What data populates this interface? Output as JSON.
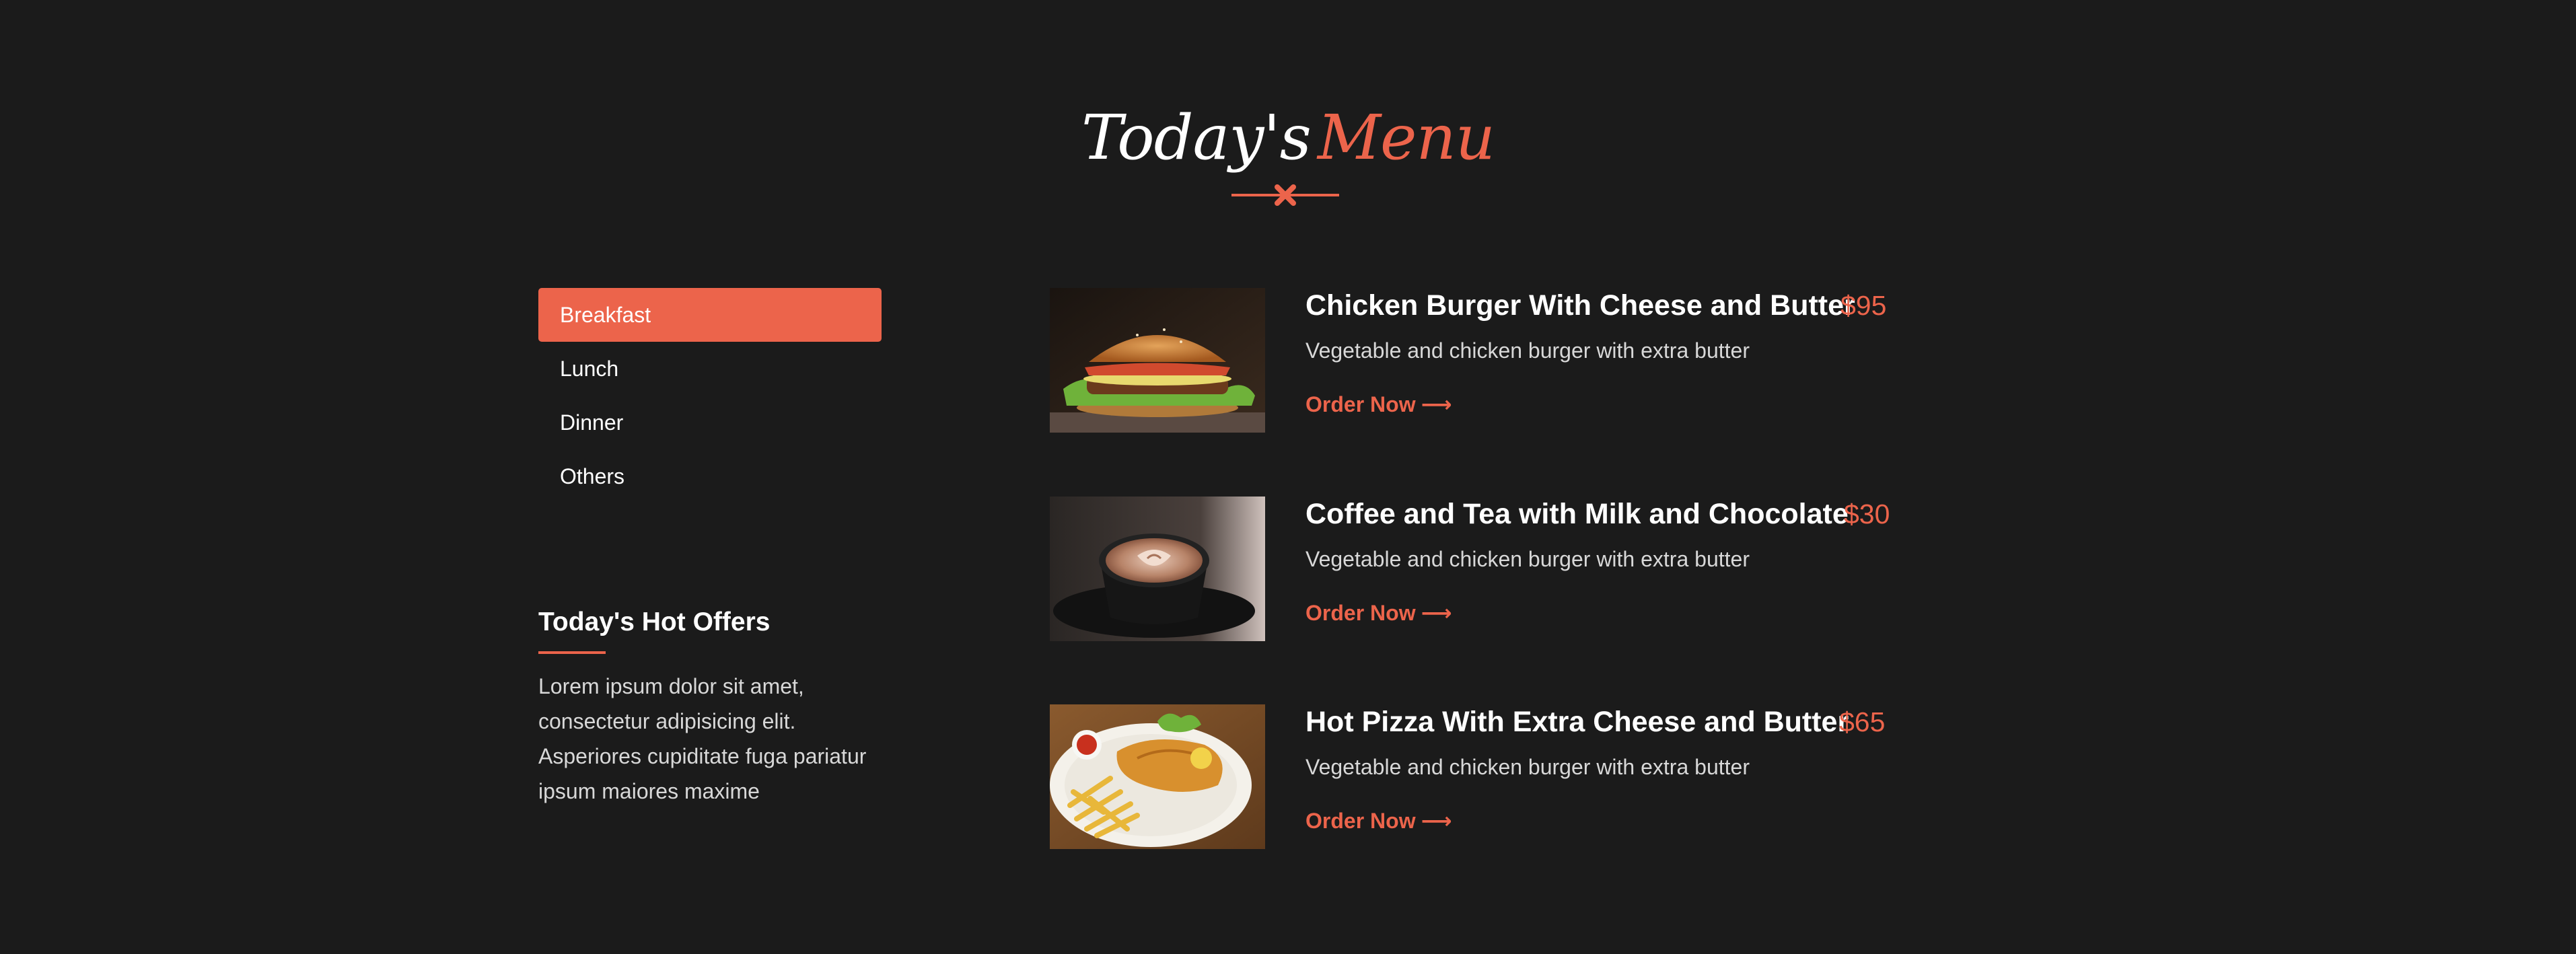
{
  "heading": {
    "word1": "Today's",
    "word2": "Menu"
  },
  "colors": {
    "accent": "#ec644b",
    "background": "#1b1b1b",
    "text": "#ffffff"
  },
  "tabs": [
    {
      "label": "Breakfast",
      "active": true
    },
    {
      "label": "Lunch",
      "active": false
    },
    {
      "label": "Dinner",
      "active": false
    },
    {
      "label": "Others",
      "active": false
    }
  ],
  "offers": {
    "title": "Today's Hot Offers",
    "text": "Lorem ipsum dolor sit amet, consectetur adipisicing elit. Asperiores cupiditate fuga pariatur ipsum maiores maxime"
  },
  "items": [
    {
      "title": "Chicken Burger With Cheese and Butter",
      "price": "$95",
      "description": "Vegetable and chicken burger with extra butter",
      "order_label": "Order Now",
      "image": "burger-photo"
    },
    {
      "title": "Coffee and Tea with Milk and Chocolate",
      "price": "$30",
      "description": "Vegetable and chicken burger with extra butter",
      "order_label": "Order Now",
      "image": "coffee-photo"
    },
    {
      "title": "Hot Pizza With Extra Cheese and Butter",
      "price": "$65",
      "description": "Vegetable and chicken burger with extra butter",
      "order_label": "Order Now",
      "image": "fish-and-chips-photo"
    }
  ]
}
